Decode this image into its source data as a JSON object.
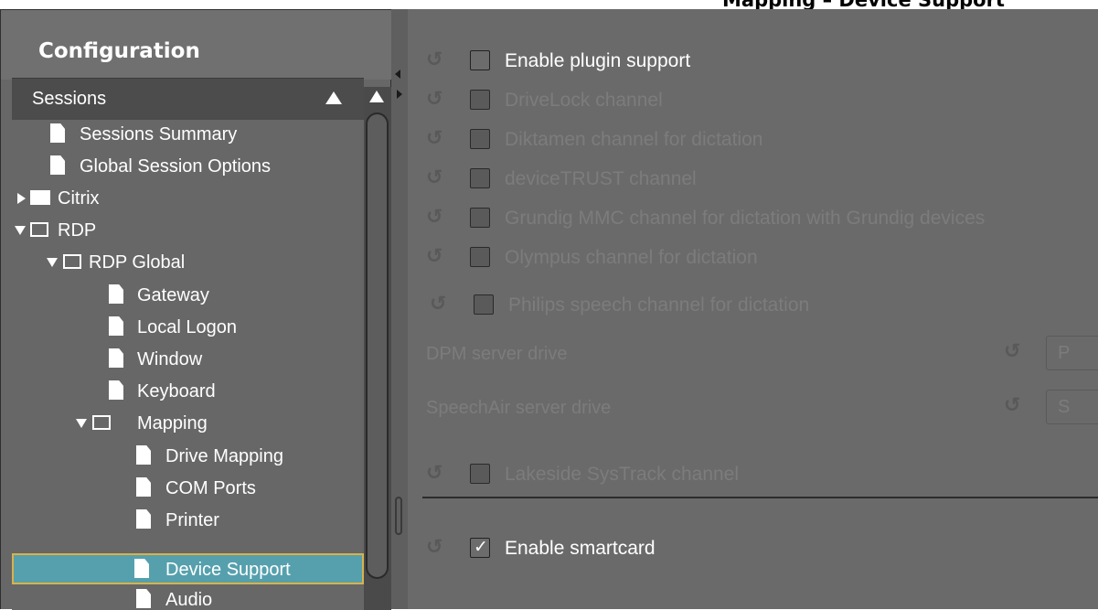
{
  "page_title": "Mapping – Device Support",
  "config": {
    "title": "Configuration",
    "section": "Sessions"
  },
  "tree": [
    {
      "label": "Sessions Summary",
      "icon": "file"
    },
    {
      "label": "Global Session Options",
      "icon": "file"
    },
    {
      "label": "Citrix",
      "icon": "folder-closed",
      "expanded": false
    },
    {
      "label": "RDP",
      "icon": "folder-open",
      "expanded": true
    },
    {
      "label": "RDP Global",
      "icon": "folder-open",
      "expanded": true
    },
    {
      "label": "Gateway",
      "icon": "file"
    },
    {
      "label": "Local Logon",
      "icon": "file"
    },
    {
      "label": "Window",
      "icon": "file"
    },
    {
      "label": "Keyboard",
      "icon": "file"
    },
    {
      "label": "Mapping",
      "icon": "folder-open",
      "expanded": true
    },
    {
      "label": "Drive Mapping",
      "icon": "file"
    },
    {
      "label": "COM Ports",
      "icon": "file"
    },
    {
      "label": "Printer",
      "icon": "file"
    },
    {
      "label": "Device Support",
      "icon": "file",
      "selected": true
    },
    {
      "label": "Audio",
      "icon": "file"
    }
  ],
  "settings": {
    "enable_plugin_support": {
      "label": "Enable plugin support",
      "checked": false,
      "enabled": true
    },
    "drivelock": {
      "label": "DriveLock channel",
      "checked": false,
      "enabled": false
    },
    "diktamen": {
      "label": "Diktamen channel for dictation",
      "checked": false,
      "enabled": false
    },
    "devicetrust": {
      "label": "deviceTRUST channel",
      "checked": false,
      "enabled": false
    },
    "grundig": {
      "label": "Grundig MMC channel for dictation with Grundig devices",
      "checked": false,
      "enabled": false
    },
    "olympus": {
      "label": "Olympus channel for dictation",
      "checked": false,
      "enabled": false
    },
    "philips": {
      "label": "Philips speech channel for dictation",
      "checked": false,
      "enabled": false
    },
    "dpm_server_drive": {
      "label": "DPM server drive",
      "value": "P",
      "enabled": false
    },
    "speechair_server_drive": {
      "label": "SpeechAir server drive",
      "value": "S",
      "enabled": false
    },
    "lakeside": {
      "label": "Lakeside SysTrack channel",
      "checked": false,
      "enabled": false
    },
    "enable_smartcard": {
      "label": "Enable smartcard",
      "checked": true,
      "enabled": true
    }
  },
  "icons": {
    "reset": "reset-icon",
    "checkmark": "✓"
  },
  "colors": {
    "selected_bg": "#56a0ad",
    "selected_border": "#d8b24a",
    "panel_bg": "#6a6a6a",
    "disabled_text": "#7c7c7c"
  }
}
